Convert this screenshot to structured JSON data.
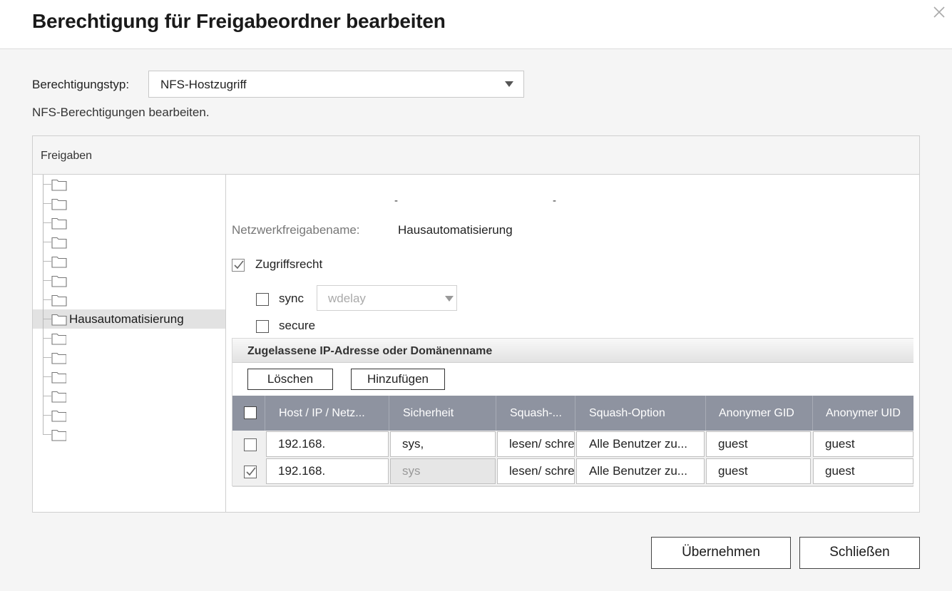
{
  "dialog": {
    "title": "Berechtigung für Freigabeordner bearbeiten",
    "close_icon": "close-icon"
  },
  "form": {
    "type_label": "Berechtigungstyp:",
    "type_value": "NFS-Hostzugriff",
    "description": "NFS-Berechtigungen bearbeiten."
  },
  "panel": {
    "header": "Freigaben",
    "tree": [
      {
        "label": "",
        "selected": false
      },
      {
        "label": "",
        "selected": false
      },
      {
        "label": "",
        "selected": false
      },
      {
        "label": "",
        "selected": false
      },
      {
        "label": "",
        "selected": false
      },
      {
        "label": "",
        "selected": false
      },
      {
        "label": "",
        "selected": false
      },
      {
        "label": "Hausautomatisierung",
        "selected": true
      },
      {
        "label": "",
        "selected": false
      },
      {
        "label": "",
        "selected": false
      },
      {
        "label": "",
        "selected": false
      },
      {
        "label": "",
        "selected": false
      },
      {
        "label": "",
        "selected": false
      },
      {
        "label": "",
        "selected": false
      }
    ]
  },
  "details": {
    "dash1": "-",
    "dash2": "-",
    "share_name_label": "Netzwerkfreigabename:",
    "share_name_value": "Hausautomatisierung",
    "access_label": "Zugriffsrecht",
    "access_checked": true,
    "sync_label": "sync",
    "sync_checked": false,
    "wdelay_value": "wdelay",
    "secure_label": "secure",
    "secure_checked": false
  },
  "ip_section": {
    "title": "Zugelassene IP-Adresse oder Domänenname",
    "delete_button": "Löschen",
    "add_button": "Hinzufügen",
    "columns": [
      "Host / IP / Netz...",
      "Sicherheit",
      "Squash-...",
      "Squash-Option",
      "Anonymer GID",
      "Anonymer UID"
    ],
    "rows": [
      {
        "checked": false,
        "host": "192.168.",
        "security": "sys,",
        "squash": "lesen/ schreiben",
        "squash_option": "Alle Benutzer zu...",
        "gid": "guest",
        "uid": "guest",
        "security_disabled": false
      },
      {
        "checked": true,
        "host": "192.168.",
        "security": "sys",
        "squash": "lesen/ schreiben",
        "squash_option": "Alle Benutzer zu...",
        "gid": "guest",
        "uid": "guest",
        "security_disabled": true
      }
    ]
  },
  "footer": {
    "apply_button": "Übernehmen",
    "close_button": "Schließen"
  }
}
